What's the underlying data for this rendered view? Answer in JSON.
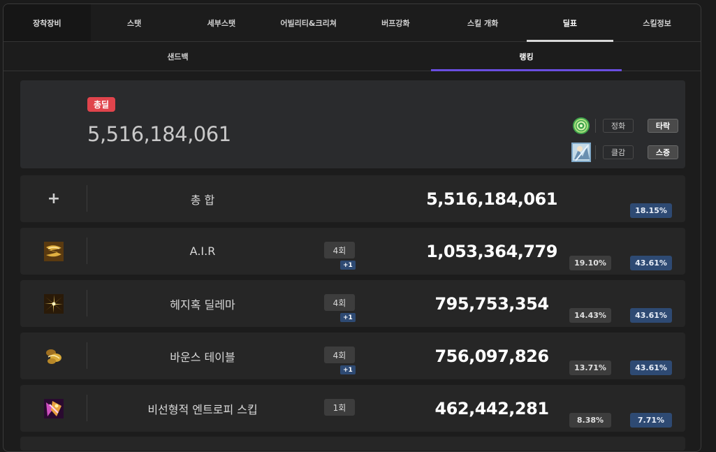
{
  "main_tabs": [
    "장착장비",
    "스탯",
    "세부스탯",
    "어빌리티&크리쳐",
    "버프강화",
    "스킬 개화",
    "딜표",
    "스킬정보"
  ],
  "sub_tabs": [
    "샌드백",
    "랭킹"
  ],
  "summary": {
    "badge": "총딜",
    "total": "5,516,184,061",
    "options": [
      {
        "icon": "green-rose-icon",
        "button1": "정화",
        "button2": "타락",
        "selected": "타락"
      },
      {
        "icon": "character-portrait-icon",
        "button1": "클감",
        "button2": "스증",
        "selected": "스증"
      }
    ]
  },
  "rows": [
    {
      "icon": "plus-icon",
      "name": "총 합",
      "count": "",
      "plus": "",
      "damage": "5,516,184,061",
      "pct1": "",
      "pct2": "18.15%"
    },
    {
      "icon": "air-skill-icon",
      "name": "A.I.R",
      "count": "4회",
      "plus": "+1",
      "damage": "1,053,364,779",
      "pct1": "19.10%",
      "pct2": "43.61%"
    },
    {
      "icon": "hedgehog-skill-icon",
      "name": "헤지혹 딜레마",
      "count": "4회",
      "plus": "+1",
      "damage": "795,753,354",
      "pct1": "14.43%",
      "pct2": "43.61%"
    },
    {
      "icon": "bounce-table-icon",
      "name": "바운스 테이블",
      "count": "4회",
      "plus": "+1",
      "damage": "756,097,826",
      "pct1": "13.71%",
      "pct2": "43.61%"
    },
    {
      "icon": "entropy-skip-icon",
      "name": "비선형적 엔트로피 스킵",
      "count": "1회",
      "plus": "",
      "damage": "462,442,281",
      "pct1": "8.38%",
      "pct2": "7.71%"
    }
  ],
  "colors": {
    "accent_red": "#e0444c",
    "accent_purple": "#6a4ee0",
    "pct_blue": "#2e4a73"
  }
}
